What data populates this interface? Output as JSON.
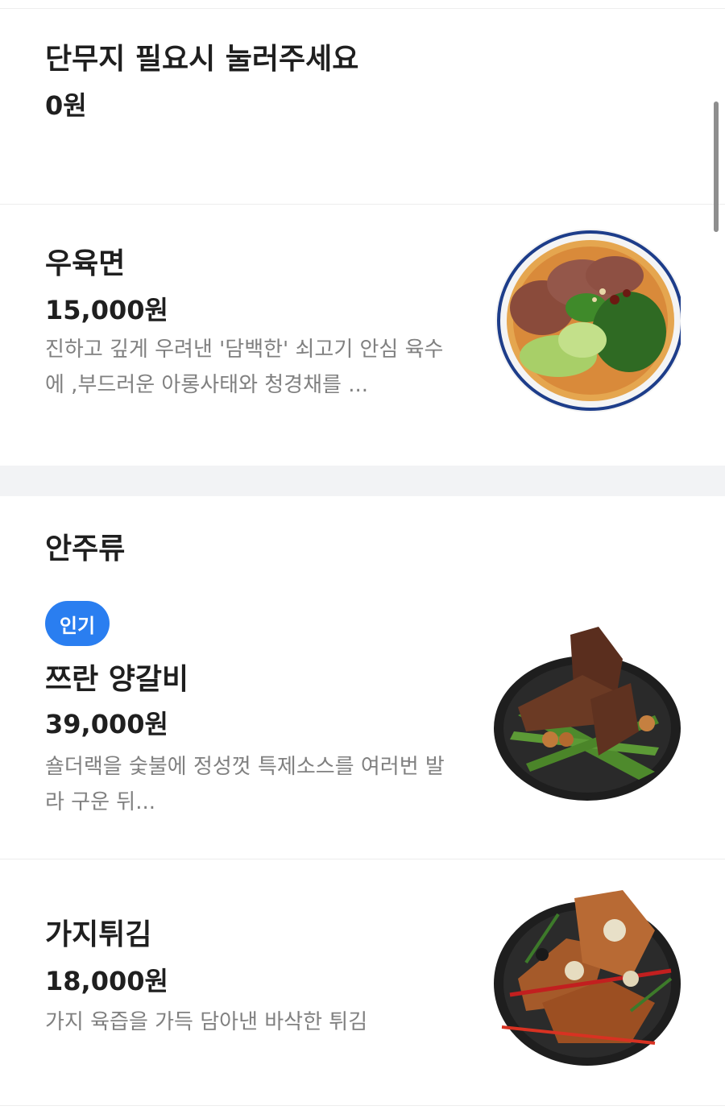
{
  "menu": {
    "items": [
      {
        "name": "단무지 필요시 눌러주세요",
        "price": "0원"
      },
      {
        "name": "우육면",
        "price": "15,000원",
        "description": "진하고 깊게 우려낸 '담백한' 쇠고기 안심 육수에 ,부드러운 아롱사태와 청경채를 ...",
        "image": "beef-noodle-soup"
      }
    ],
    "section": {
      "title": "안주류",
      "items": [
        {
          "badge": "인기",
          "name": "쯔란 양갈비",
          "price": "39,000원",
          "description": "숄더랙을 숯불에 정성껏 특제소스를 여러번 발라 구운 뒤...",
          "image": "cumin-lamb-ribs"
        },
        {
          "name": "가지튀김",
          "price": "18,000원",
          "description": "가지 육즙을 가득 담아낸 바삭한 튀김",
          "image": "fried-eggplant"
        }
      ]
    }
  },
  "colors": {
    "badge": "#2a7ef0",
    "section_gap": "#f2f3f5",
    "description": "#808080"
  }
}
